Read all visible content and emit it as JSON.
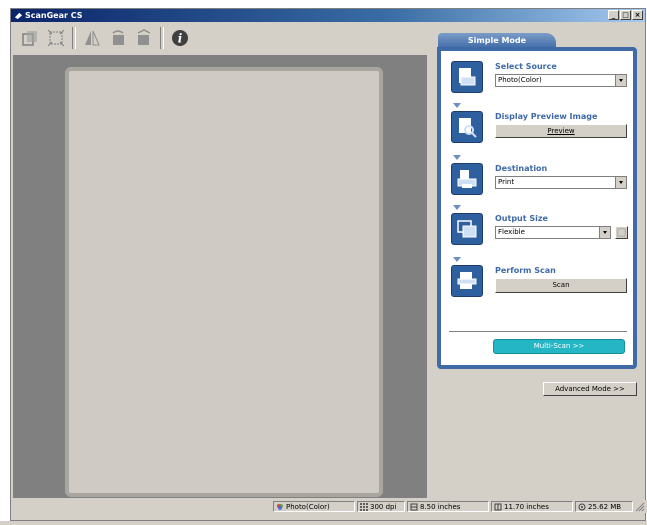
{
  "window": {
    "title": "ScanGear CS",
    "min": "_",
    "max": "□",
    "close": "×"
  },
  "toolbar": {
    "items": [
      "crop-icon",
      "select-all-icon",
      "mirror-icon",
      "rotate-left-icon",
      "rotate-right-icon",
      "info-icon"
    ]
  },
  "panel": {
    "tab": "Simple Mode",
    "steps": {
      "source": {
        "label": "Select Source",
        "value": "Photo(Color)"
      },
      "preview": {
        "label": "Display Preview Image",
        "button": "Preview"
      },
      "destination": {
        "label": "Destination",
        "value": "Print"
      },
      "output": {
        "label": "Output Size",
        "value": "Flexible"
      },
      "scan": {
        "label": "Perform Scan",
        "button": "Scan"
      }
    },
    "multiscan": "Multi-Scan >>"
  },
  "advanced_button": "Advanced Mode >>",
  "status": {
    "mode": "Photo(Color)",
    "dpi": "300 dpi",
    "width": "8.50 inches",
    "height": "11.70 inches",
    "size": "25.62 MB"
  }
}
